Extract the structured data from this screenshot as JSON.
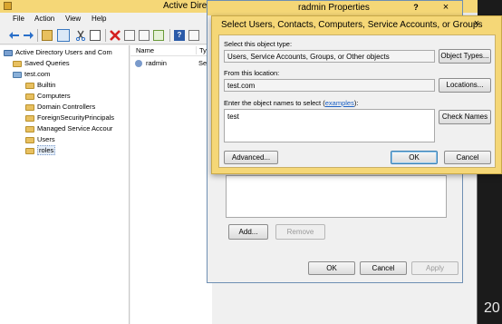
{
  "main_window": {
    "title": "Active Direct",
    "menu": [
      "File",
      "Action",
      "View",
      "Help"
    ]
  },
  "tree": {
    "root": "Active Directory Users and Com",
    "saved_queries": "Saved Queries",
    "domain": "test.com",
    "children": [
      "Builtin",
      "Computers",
      "Domain Controllers",
      "ForeignSecurityPrincipals",
      "Managed Service Accour",
      "Users",
      "roles"
    ]
  },
  "list": {
    "columns": [
      "Name",
      "Ty"
    ],
    "rows": [
      {
        "name": "radmin",
        "type": "Se"
      }
    ]
  },
  "props_dialog": {
    "title": "radmin Properties",
    "help": "?",
    "close": "×",
    "add_label": "Add...",
    "remove_label": "Remove",
    "ok_label": "OK",
    "cancel_label": "Cancel",
    "apply_label": "Apply"
  },
  "select_dialog": {
    "title": "Select Users, Contacts, Computers, Service Accounts, or Groups",
    "close": "×",
    "object_type_label": "Select this object type:",
    "object_type_value": "Users, Service Accounts, Groups, or Other objects",
    "object_types_button": "Object Types...",
    "location_label": "From this location:",
    "location_value": "test.com",
    "locations_button": "Locations...",
    "names_label_pre": "Enter the object names to select (",
    "names_label_link": "examples",
    "names_label_post": "):",
    "names_value": "test",
    "check_names_button": "Check Names",
    "advanced_button": "Advanced...",
    "ok_button": "OK",
    "cancel_button": "Cancel"
  },
  "clock_fragment": "20"
}
